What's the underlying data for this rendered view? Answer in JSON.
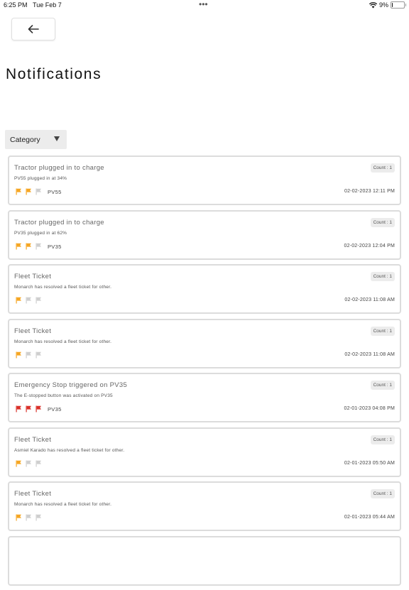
{
  "status_bar": {
    "time": "6:25 PM",
    "date": "Tue Feb 7",
    "battery": "9%",
    "battery_level": 0.09
  },
  "header": {
    "back_icon": "arrow-left-icon",
    "title": "Notifications"
  },
  "filter": {
    "category_label": "Category",
    "caret_icon": "caret-down-icon"
  },
  "colors": {
    "flag_orange": "#f5a623",
    "flag_red": "#d9312a",
    "flag_gray": "#cfcfcf"
  },
  "notifications": [
    {
      "title": "Tractor plugged in to charge",
      "description": "PV55 plugged in at 34%",
      "flags": [
        "orange",
        "orange",
        "gray"
      ],
      "vehicle": "PV55",
      "count": "Count : 1",
      "timestamp": "02-02-2023 12:11 PM"
    },
    {
      "title": "Tractor plugged in to charge",
      "description": "PV35 plugged in at 62%",
      "flags": [
        "orange",
        "orange",
        "gray"
      ],
      "vehicle": "PV35",
      "count": "Count : 1",
      "timestamp": "02-02-2023 12:04 PM"
    },
    {
      "title": "Fleet Ticket",
      "description": "Monarch has resolved a fleet ticket for other.",
      "flags": [
        "orange",
        "gray",
        "gray"
      ],
      "vehicle": "",
      "count": "Count : 1",
      "timestamp": "02-02-2023 11:08 AM"
    },
    {
      "title": "Fleet Ticket",
      "description": "Monarch has resolved a fleet ticket for other.",
      "flags": [
        "orange",
        "gray",
        "gray"
      ],
      "vehicle": "",
      "count": "Count : 1",
      "timestamp": "02-02-2023 11:08 AM"
    },
    {
      "title": "Emergency Stop triggered on PV35",
      "description": "The E-stopped button was activated on PV35",
      "flags": [
        "red",
        "red",
        "red"
      ],
      "vehicle": "PV35",
      "count": "Count : 1",
      "timestamp": "02-01-2023 04:08 PM"
    },
    {
      "title": "Fleet Ticket",
      "description": "Asmiel Karado has resolved a fleet ticket for other.",
      "flags": [
        "orange",
        "gray",
        "gray"
      ],
      "vehicle": "",
      "count": "Count : 1",
      "timestamp": "02-01-2023 05:50 AM"
    },
    {
      "title": "Fleet Ticket",
      "description": "Monarch has resolved a fleet ticket for other.",
      "flags": [
        "orange",
        "gray",
        "gray"
      ],
      "vehicle": "",
      "count": "Count : 1",
      "timestamp": "02-01-2023 05:44 AM"
    },
    {
      "title": "",
      "description": "",
      "flags": [],
      "vehicle": "",
      "count": "",
      "timestamp": ""
    }
  ]
}
